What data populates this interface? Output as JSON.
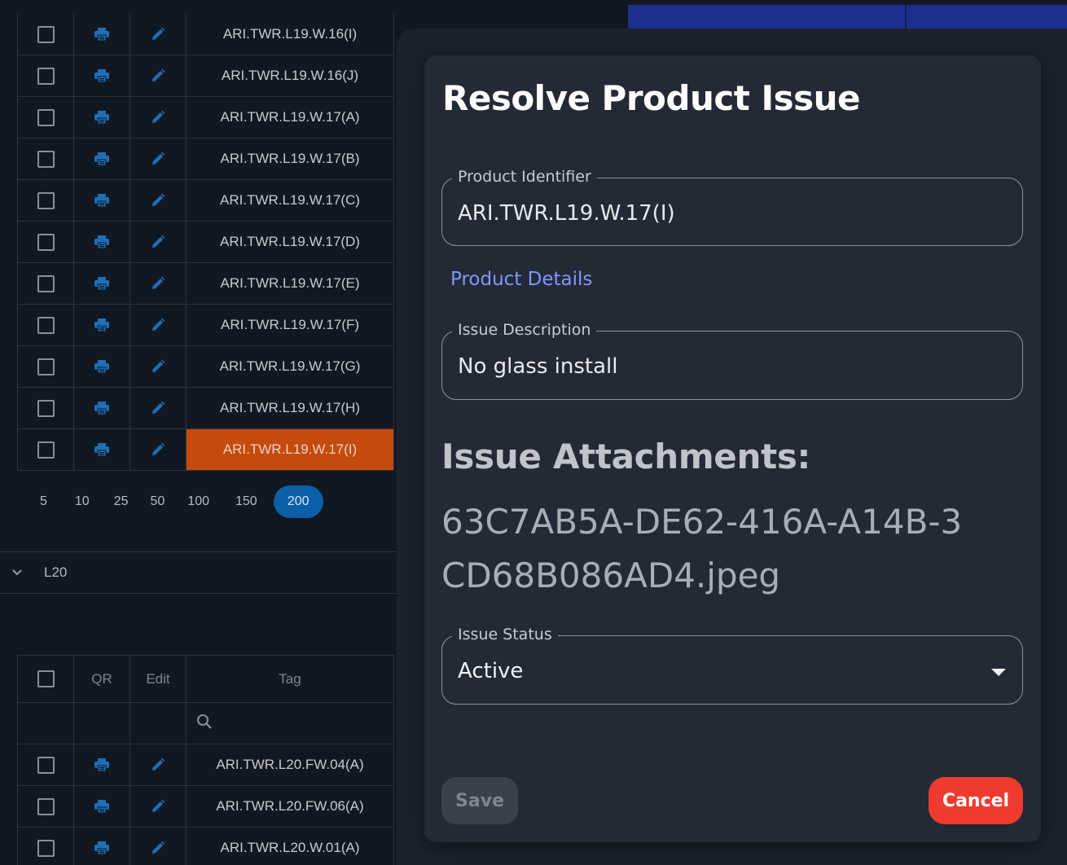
{
  "colors": {
    "accent_blue": "#0b5fa7",
    "selected_row": "#c44a0e",
    "cancel_red": "#ef3b2f",
    "link_blue": "#7f98ff"
  },
  "table_top": {
    "rows": [
      {
        "tag": "ARI.TWR.L19.W.16(I)"
      },
      {
        "tag": "ARI.TWR.L19.W.16(J)"
      },
      {
        "tag": "ARI.TWR.L19.W.17(A)"
      },
      {
        "tag": "ARI.TWR.L19.W.17(B)"
      },
      {
        "tag": "ARI.TWR.L19.W.17(C)"
      },
      {
        "tag": "ARI.TWR.L19.W.17(D)"
      },
      {
        "tag": "ARI.TWR.L19.W.17(E)"
      },
      {
        "tag": "ARI.TWR.L19.W.17(F)"
      },
      {
        "tag": "ARI.TWR.L19.W.17(G)"
      },
      {
        "tag": "ARI.TWR.L19.W.17(H)"
      },
      {
        "tag": "ARI.TWR.L19.W.17(I)",
        "selected": true
      }
    ],
    "icons": {
      "qr": "print-icon",
      "edit": "pencil-icon"
    }
  },
  "pager": {
    "sizes": [
      "5",
      "10",
      "25",
      "50",
      "100",
      "150",
      "200"
    ],
    "active": "200"
  },
  "group": {
    "label": "L20",
    "chevron": "chevron-down-icon"
  },
  "table_bottom": {
    "headers": {
      "qr": "QR",
      "edit": "Edit",
      "tag": "Tag"
    },
    "filter_icon": "search-icon",
    "rows": [
      {
        "tag": "ARI.TWR.L20.FW.04(A)"
      },
      {
        "tag": "ARI.TWR.L20.FW.06(A)"
      },
      {
        "tag": "ARI.TWR.L20.W.01(A)"
      }
    ]
  },
  "dialog": {
    "title": "Resolve Product Issue",
    "product_identifier": {
      "label": "Product Identifier",
      "value": "ARI.TWR.L19.W.17(I)"
    },
    "product_details_link": "Product Details",
    "issue_description": {
      "label": "Issue Description",
      "value": "No glass install"
    },
    "attachments_heading": "Issue Attachments:",
    "attachment_file": "63C7AB5A-DE62-416A-A14B-3CD68B086AD4.jpeg",
    "issue_status": {
      "label": "Issue Status",
      "value": "Active"
    },
    "save_label": "Save",
    "cancel_label": "Cancel"
  }
}
